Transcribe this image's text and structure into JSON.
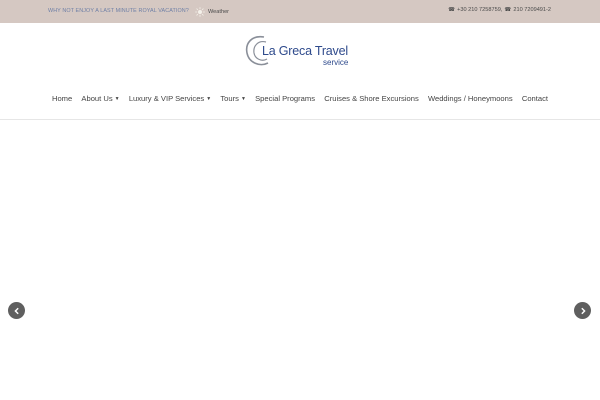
{
  "topbar": {
    "promo": "WHY NOT ENJOY A LAST MINUTE ROYAL VACATION?",
    "weather_label": "Weather",
    "phone1": "+30 210 7258759,",
    "phone2": "210 7209491-2"
  },
  "logo": {
    "brand": "La Greca Travel",
    "sub": "service"
  },
  "nav": {
    "items": [
      {
        "label": "Home",
        "has_dropdown": false
      },
      {
        "label": "About Us",
        "has_dropdown": true
      },
      {
        "label": "Luxury & VIP Services",
        "has_dropdown": true
      },
      {
        "label": "Tours",
        "has_dropdown": true
      },
      {
        "label": "Special Programs",
        "has_dropdown": false
      },
      {
        "label": "Cruises & Shore Excursions",
        "has_dropdown": false
      },
      {
        "label": "Weddings / Honeymoons",
        "has_dropdown": false
      },
      {
        "label": "Contact",
        "has_dropdown": false
      }
    ]
  },
  "colors": {
    "topbar_bg": "#d5c8c2",
    "brand_blue": "#2e4a8c",
    "arrow_bg": "#5f5f5f"
  },
  "icons": {
    "weather": "sun-icon",
    "phone": "phone-icon",
    "prev": "chevron-left-icon",
    "next": "chevron-right-icon",
    "caret": "caret-down-icon"
  }
}
